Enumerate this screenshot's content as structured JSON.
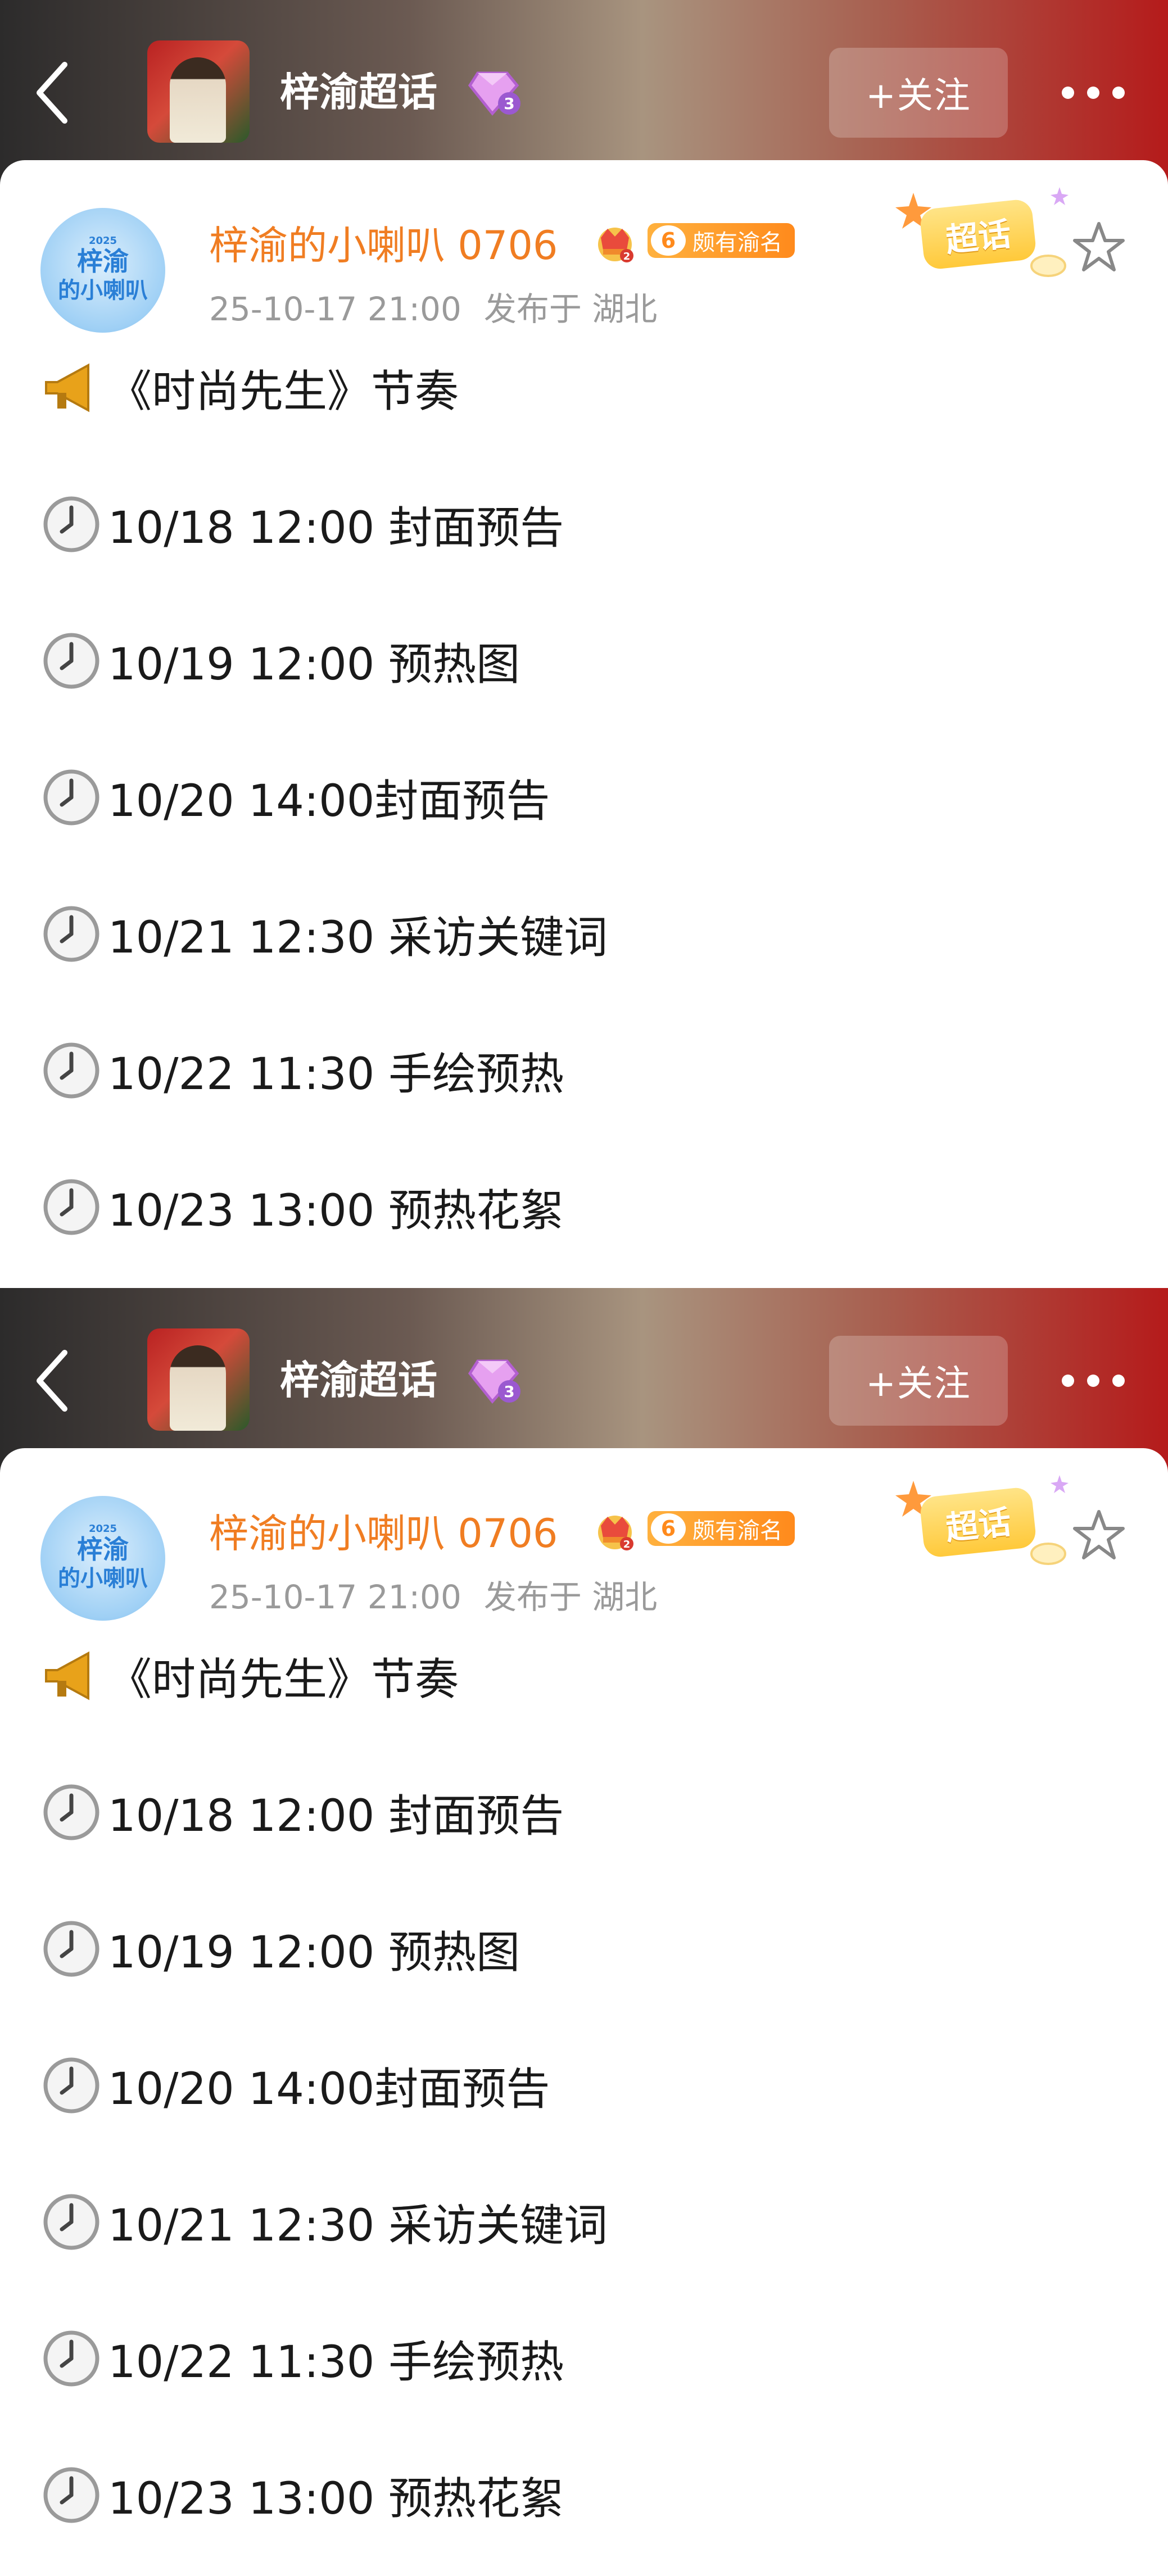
{
  "topic": {
    "title": "梓渝超话",
    "follow_label": "+关注",
    "level_icon": "gem-level-3-icon"
  },
  "post": {
    "author": "梓渝的小喇叭 0706",
    "avatar_text": [
      "梓渝",
      "的小喇叭"
    ],
    "fan_badge_level": "6",
    "fan_badge_text": "颇有渝名",
    "super_badge_text": "超话",
    "date": "25-10-17 21:00",
    "location": "发布于 湖北",
    "title_line": "《时尚先生》节奏",
    "schedule": [
      "10/18 12:00 封面预告",
      "10/19 12:00 预热图",
      "10/20 14:00封面预告",
      "10/21 12:30 采访关键词",
      "10/22 11:30 手绘预热",
      "10/23 13:00 预热花絮"
    ]
  },
  "colors": {
    "username": "#f07d22",
    "meta": "#9a9a9a",
    "badge": "#ff8a1c"
  }
}
